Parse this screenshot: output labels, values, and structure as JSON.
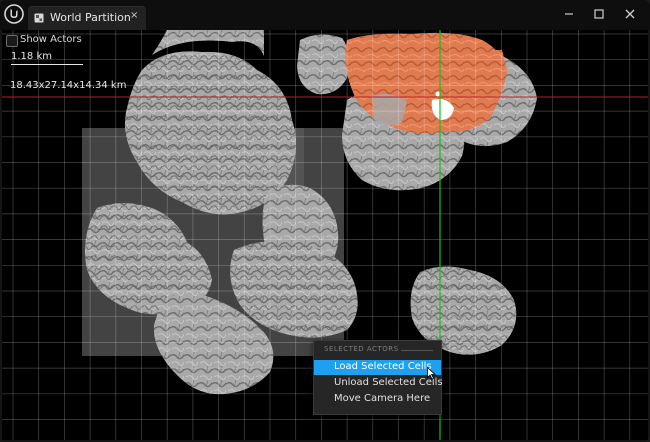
{
  "window": {
    "tab_title": "World Partition",
    "tab_close": "×"
  },
  "viewport": {
    "show_actors_label": "Show Actors",
    "show_actors_checked": false,
    "scale_label": "1.18 km",
    "dimensions_label": "18.43x27.14x14.34 km"
  },
  "context_menu": {
    "section_header": "SELECTED ACTORS",
    "items": [
      {
        "label": "Load Selected Cells",
        "highlighted": true
      },
      {
        "label": "Unload Selected Cells",
        "highlighted": false
      },
      {
        "label": "Move Camera Here",
        "highlighted": false
      }
    ]
  },
  "colors": {
    "grid": "#ffffff",
    "x_axis": "#b42020",
    "y_axis": "#16c016",
    "selection": "#5a5a5a",
    "highlight": "#1ea0f0",
    "loaded_terrain": "#e07a50"
  },
  "icons": {
    "app_logo": "unreal-engine-logo-icon",
    "tab_icon": "world-partition-icon",
    "minimize": "minimize-icon",
    "maximize": "maximize-icon",
    "close": "close-icon",
    "cursor": "mouse-pointer-icon"
  }
}
